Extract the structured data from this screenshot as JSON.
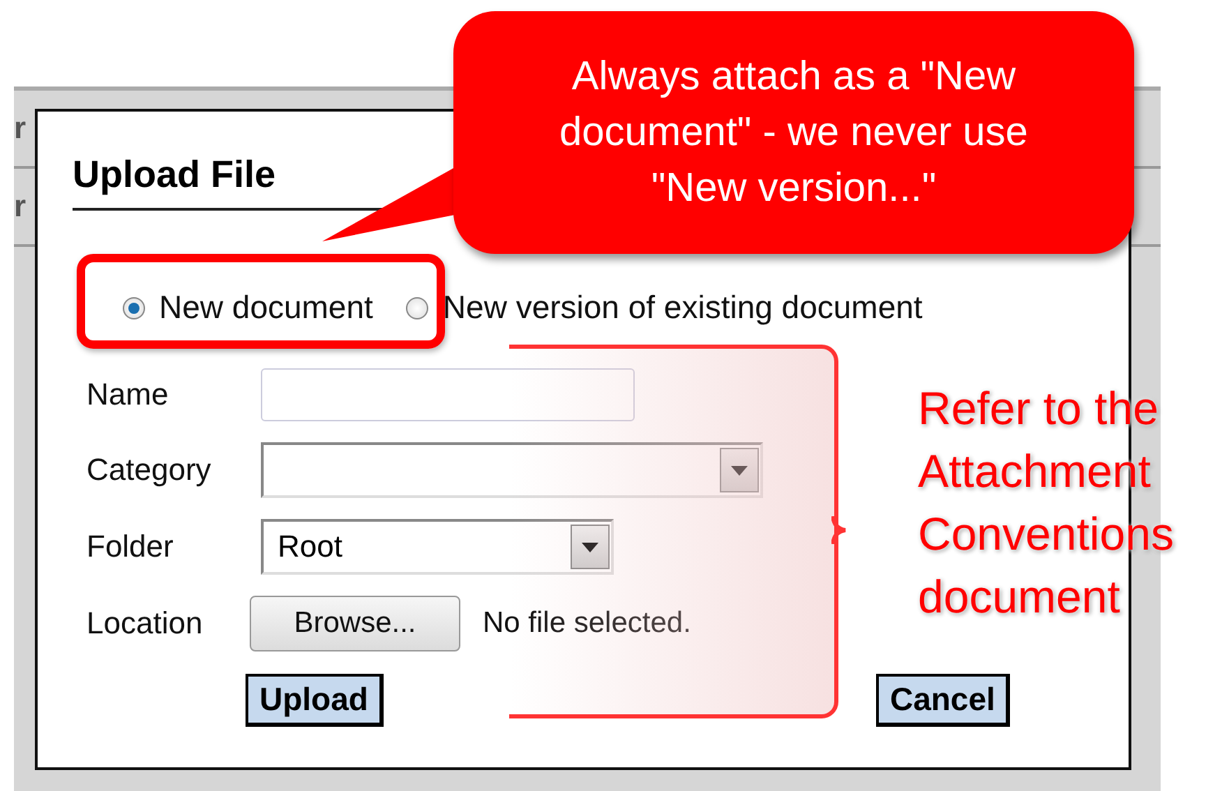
{
  "background": {
    "row_texts": [
      "r",
      "r"
    ]
  },
  "dialog": {
    "title": "Upload File",
    "options": [
      {
        "label": "New document",
        "selected": true
      },
      {
        "label": "New version of existing document",
        "selected": false
      }
    ],
    "fields": [
      {
        "kind": "text",
        "label": "Name"
      },
      {
        "kind": "select",
        "label": "Category"
      },
      {
        "kind": "select",
        "label": "Folder",
        "value": "Root"
      },
      {
        "kind": "file",
        "label": "Location",
        "button": "Browse...",
        "status": "No file selected."
      }
    ],
    "buttons": [
      "Upload",
      "Cancel"
    ]
  },
  "annotations": {
    "callout": "Always attach as a \"New document\" - we never use \"New version...\"",
    "side_note": "Refer to the Attachment Conventions document"
  }
}
